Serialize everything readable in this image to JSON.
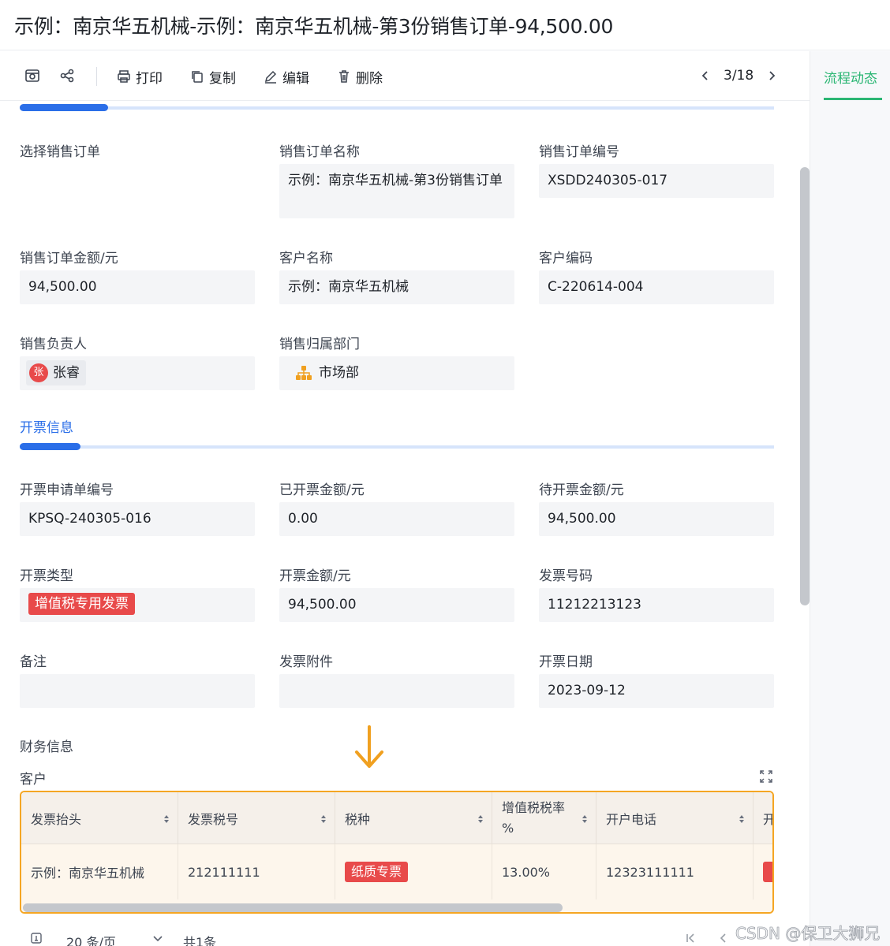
{
  "page_title": "示例：南京华五机械-示例：南京华五机械-第3份销售订单-94,500.00",
  "toolbar": {
    "print_label": "打印",
    "copy_label": "复制",
    "edit_label": "编辑",
    "delete_label": "删除",
    "pager_text": "3/18"
  },
  "right_panel": {
    "tab_label": "流程动态"
  },
  "order": {
    "select_order_label": "选择销售订单",
    "order_name_label": "销售订单名称",
    "order_name_value": "示例：南京华五机械-第3份销售订单",
    "order_no_label": "销售订单编号",
    "order_no_value": "XSDD240305-017",
    "amount_label": "销售订单金额/元",
    "amount_value": "94,500.00",
    "customer_name_label": "客户名称",
    "customer_name_value": "示例：南京华五机械",
    "customer_code_label": "客户编码",
    "customer_code_value": "C-220614-004",
    "owner_label": "销售负责人",
    "owner_avatar": "张",
    "owner_name": "张睿",
    "dept_label": "销售归属部门",
    "dept_name": "市场部"
  },
  "invoice_section": {
    "title": "开票信息",
    "apply_no_label": "开票申请单编号",
    "apply_no_value": "KPSQ-240305-016",
    "invoiced_label": "已开票金额/元",
    "invoiced_value": "0.00",
    "pending_label": "待开票金额/元",
    "pending_value": "94,500.00",
    "type_label": "开票类型",
    "type_value": "增值税专用发票",
    "amount_label": "开票金额/元",
    "amount_value": "94,500.00",
    "invoice_no_label": "发票号码",
    "invoice_no_value": "11212213123",
    "remark_label": "备注",
    "attachment_label": "发票附件",
    "date_label": "开票日期",
    "date_value": "2023-09-12"
  },
  "finance": {
    "title": "财务信息",
    "sub_label": "客户",
    "columns": [
      "发票抬头",
      "发票税号",
      "税种",
      "增值税税率",
      "%",
      "开户电话",
      "开"
    ],
    "row": {
      "title": "示例：南京华五机械",
      "tax_no": "212111111",
      "tax_type": "纸质专票",
      "rate": "13.00%",
      "phone": "12323111111"
    }
  },
  "footer": {
    "page_size": "20 条/页",
    "total": "共1条"
  },
  "watermark": "CSDN @保卫大狮兄",
  "colors": {
    "accent_blue": "#2a6ee8",
    "accent_green": "#2bb673",
    "tag_red": "#e84a4a",
    "highlight_orange": "#f5a623"
  }
}
